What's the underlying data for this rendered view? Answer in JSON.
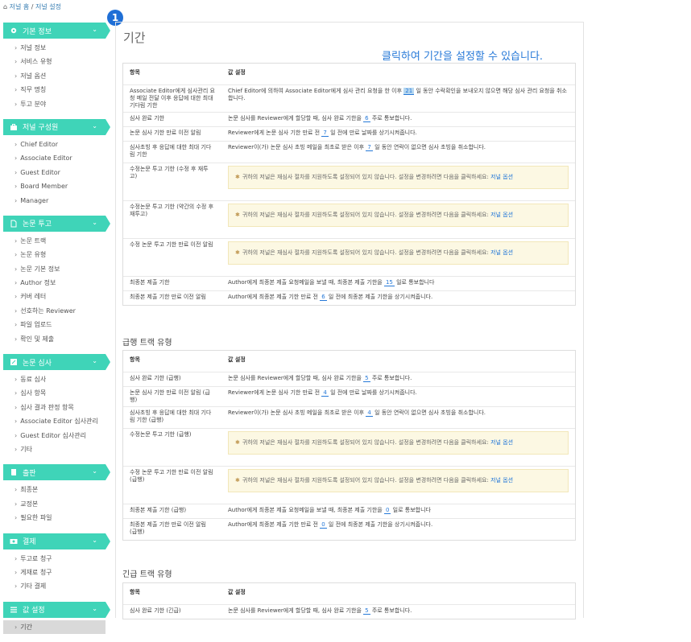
{
  "breadcrumb": {
    "home": "저널 홈",
    "sep": "/",
    "current": "저널 설정"
  },
  "badge": "1",
  "sidebar": [
    {
      "title": "기본 정보",
      "icon": "gear-icon",
      "items": [
        "저널 정보",
        "서비스 유형",
        "저널 옵션",
        "직무 명칭",
        "투고 분야"
      ]
    },
    {
      "title": "저널 구성원",
      "icon": "briefcase-icon",
      "items": [
        "Chief Editor",
        "Associate Editor",
        "Guest Editor",
        "Board Member",
        "Manager"
      ]
    },
    {
      "title": "논문 투고",
      "icon": "document-icon",
      "items": [
        "논문 트랙",
        "논문 유형",
        "논문 기본 정보",
        "Author 정보",
        "커버 레터",
        "선호하는 Reviewer",
        "파일 업로드",
        "확인 및 제출"
      ]
    },
    {
      "title": "논문 심사",
      "icon": "edit-icon",
      "items": [
        "동료 심사",
        "심사 항목",
        "심사 결과 판정 항목",
        "Associate Editor 심사관리",
        "Guest Editor 심사관리",
        "기타"
      ]
    },
    {
      "title": "출판",
      "icon": "book-icon",
      "items": [
        "최종본",
        "교정본",
        "필요한 파일"
      ]
    },
    {
      "title": "결제",
      "icon": "money-icon",
      "items": [
        "투고료 청구",
        "게재료 청구",
        "기타 결제"
      ]
    },
    {
      "title": "값 설정",
      "icon": "list-icon",
      "items": [
        "기간"
      ]
    }
  ],
  "main": {
    "title": "기간",
    "hint": "클릭하여 기간을 설정할 수 있습니다.",
    "col_item": "항목",
    "col_value": "값 설정",
    "warn_text": "귀하의 저널은 재심사 절차를 지원하도록 설정되어 있지 않습니다. 설정을 변경하려면 다음을 클릭하세요:",
    "warn_link": "저널 옵션",
    "regular": [
      {
        "label": "Associate Editor에게 심사관리 요청 메일 전달 이후 응답에 대한 최대 기다림 기한",
        "pre": "Chief Editor에 의하여 Associate Editor에게 심사 관리 요청을 한 이후",
        "num": "21",
        "post": "일 동안 수락확인을 보내오지 않으면 해당 심사 관리 요청을 취소합니다."
      },
      {
        "label": "심사 완료 기한",
        "pre": "논문 심사를 Reviewer에게 할당할 때, 심사 완료 기한을",
        "num": "6",
        "post": "주로 통보합니다."
      },
      {
        "label": "논문 심사 기한 만료 이전 알림",
        "pre": "Reviewer에게 논문 심사 기한 만료 전",
        "num": "7",
        "post": "일 전에 만료 날짜를 상기시켜줍니다."
      },
      {
        "label": "심사초빙 후 응답에 대한 최대 기다림 기한",
        "pre": "Reviewer이(가) 논문 심사 초빙 메일을 최초로 받은 이후",
        "num": "7",
        "post": "일 동안 연락이 없으면 심사 초빙을 취소합니다."
      },
      {
        "label": "수정논문 투고 기한 (수정 후 재투고)"
      },
      {
        "label": "수정논문 투고 기한 (약간의 수정 후 재투고)"
      },
      {
        "label": "수정 논문 투고 기한 만료 이전 알림"
      },
      {
        "label": "최종본 제출 기한",
        "pre": "Author에게 최종본 제출 요청메일을 보낼 때, 최종본 제출 기한을",
        "num": "15",
        "post": "일로 통보합니다"
      },
      {
        "label": "최종본 제출 기한 만료 이전 알림",
        "pre": "Author에게 최종본 제출 기한 만료 전",
        "num": "6",
        "post": "일 전에 최종본 제출 기한을 상기시켜줍니다."
      }
    ],
    "fast_title": "급행 트랙 유형",
    "fast": [
      {
        "label": "심사 완료 기한 (급행)",
        "pre": "논문 심사를 Reviewer에게 할당할 때, 심사 완료 기한을",
        "num": "5",
        "post": "주로 통보합니다."
      },
      {
        "label": "논문 심사 기한 만료 이전 알림 (급행)",
        "pre": "Reviewer에게 논문 심사 기한 만료 전",
        "num": "4",
        "post": "일 전에 만료 날짜를 상기시켜줍니다."
      },
      {
        "label": "심사초빙 후 응답에 대한 최대 기다림 기한 (급행)",
        "pre": "Reviewer이(가) 논문 심사 초빙 메일을 최초로 받은 이후",
        "num": "4",
        "post": "일 동안 연락이 없으면 심사 초빙을 취소합니다."
      },
      {
        "label": "수정논문 투고 기한 (급행)"
      },
      {
        "label": "수정 논문 투고 기한 만료 이전 알림 (급행)"
      },
      {
        "label": "최종본 제출 기한 (급행)",
        "pre": "Author에게 최종본 제출 요청메일을 보낼 때, 최종본 제출 기한을",
        "num": "0",
        "post": "일로 통보합니다"
      },
      {
        "label": "최종본 제출 기한 만료 이전 알림 (급행)",
        "pre": "Author에게 최종본 제출 기한 만료 전",
        "num": "0",
        "post": "일 전에 최종본 제출 기한을 상기시켜줍니다."
      }
    ],
    "urgent_title": "긴급 트랙 유형",
    "urgent": [
      {
        "label": "심사 완료 기한 (긴급)",
        "pre": "논문 심사를 Reviewer에게 할당할 때, 심사 완료 기한을",
        "num": "5",
        "post": "주로 통보합니다."
      }
    ]
  }
}
